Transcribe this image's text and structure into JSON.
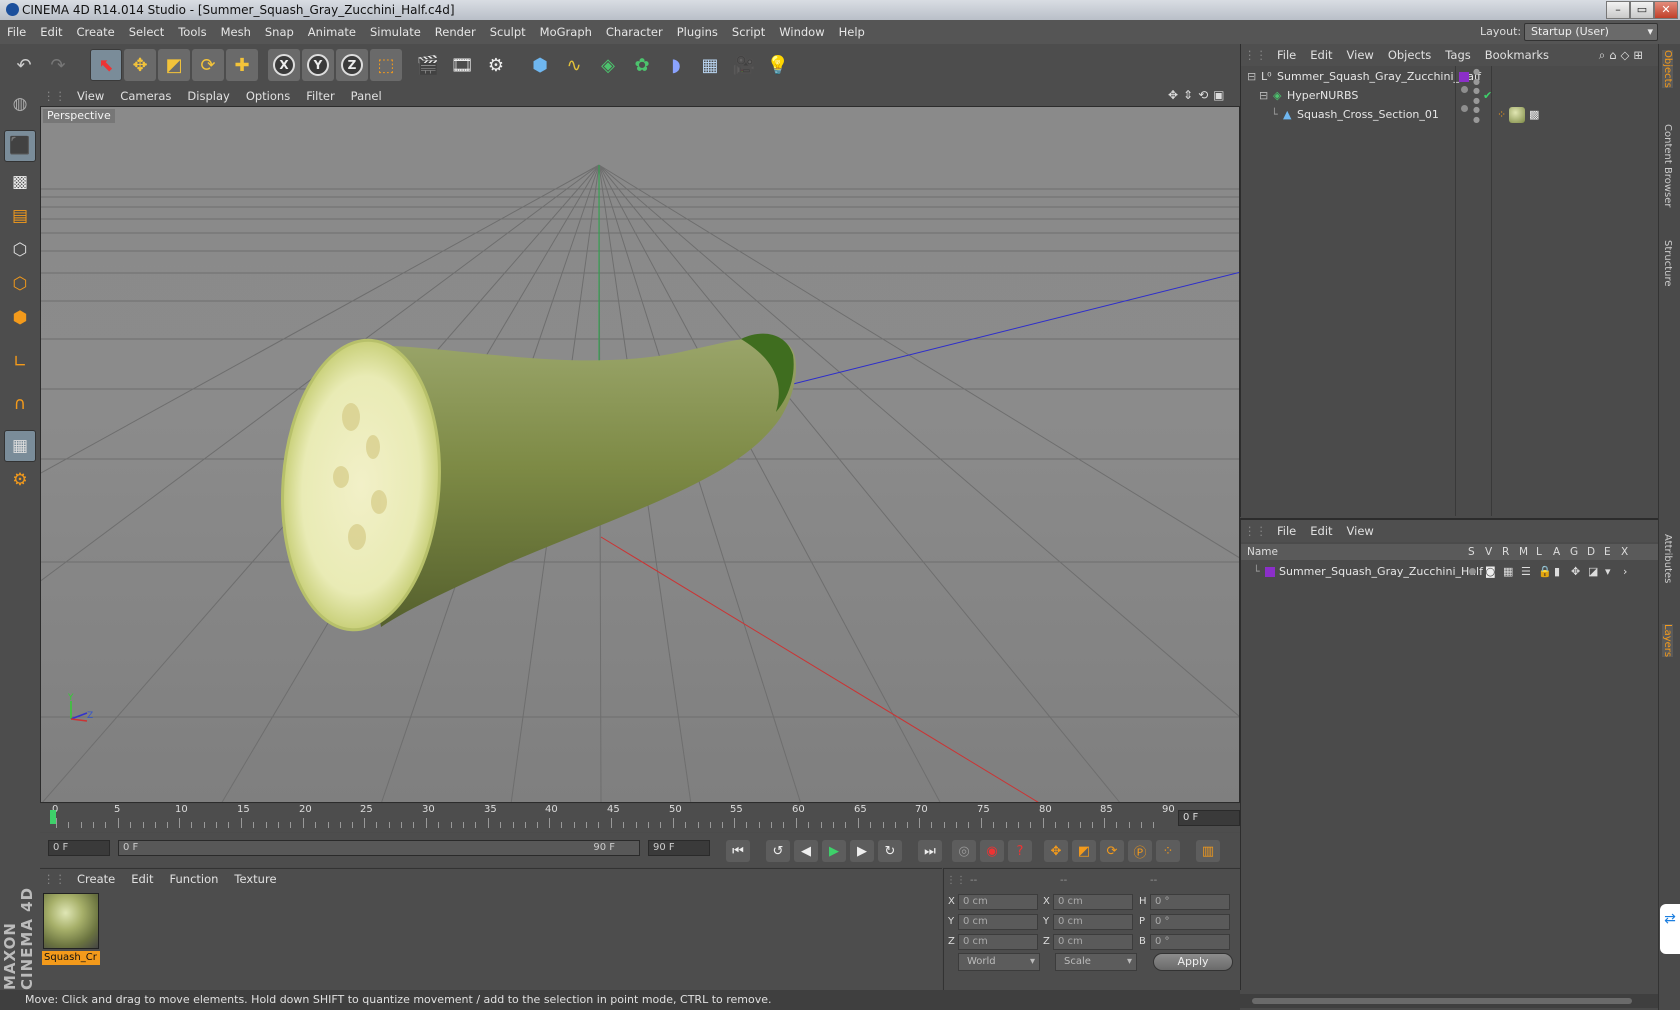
{
  "window": {
    "title": "CINEMA 4D R14.014 Studio - [Summer_Squash_Gray_Zucchini_Half.c4d]",
    "minimize": "–",
    "maximize": "▭",
    "close": "✕"
  },
  "menubar": {
    "items": [
      "File",
      "Edit",
      "Create",
      "Select",
      "Tools",
      "Mesh",
      "Snap",
      "Animate",
      "Simulate",
      "Render",
      "Sculpt",
      "MoGraph",
      "Character",
      "Plugins",
      "Script",
      "Window",
      "Help"
    ],
    "layout_label": "Layout:",
    "layout_value": "Startup (User)"
  },
  "viewport": {
    "menu": [
      "View",
      "Cameras",
      "Display",
      "Options",
      "Filter",
      "Panel"
    ],
    "camera_label": "Perspective",
    "axis_y": "Y",
    "axis_z": "Z"
  },
  "timeline": {
    "ticks": [
      "0",
      "5",
      "10",
      "15",
      "20",
      "25",
      "30",
      "35",
      "40",
      "45",
      "50",
      "55",
      "60",
      "65",
      "70",
      "75",
      "80",
      "85",
      "90"
    ],
    "current_frame": "0 F",
    "start_frame": "0 F",
    "range_start": "0 F",
    "range_end": "90 F",
    "end_frame": "90 F"
  },
  "material_manager": {
    "menu": [
      "Create",
      "Edit",
      "Function",
      "Texture"
    ],
    "material_name": "Squash_Cr"
  },
  "coordinates": {
    "headers": [
      "--",
      "--",
      "--"
    ],
    "rows": [
      {
        "a": "X",
        "av": "0 cm",
        "b": "X",
        "bv": "0 cm",
        "c": "H",
        "cv": "0 °"
      },
      {
        "a": "Y",
        "av": "0 cm",
        "b": "Y",
        "bv": "0 cm",
        "c": "P",
        "cv": "0 °"
      },
      {
        "a": "Z",
        "av": "0 cm",
        "b": "Z",
        "bv": "0 cm",
        "c": "B",
        "cv": "0 °"
      }
    ],
    "mode": "World",
    "size_mode": "Scale",
    "apply": "Apply"
  },
  "status": "Move: Click and drag to move elements. Hold down SHIFT to quantize movement / add to the selection in point mode, CTRL to remove.",
  "object_manager": {
    "menu": [
      "File",
      "Edit",
      "View",
      "Objects",
      "Tags",
      "Bookmarks"
    ],
    "objects": [
      {
        "name": "Summer_Squash_Gray_Zucchini_Half"
      },
      {
        "name": "HyperNURBS"
      },
      {
        "name": "Squash_Cross_Section_01"
      }
    ]
  },
  "layer_manager": {
    "menu": [
      "File",
      "Edit",
      "View"
    ],
    "columns": [
      "Name",
      "S",
      "V",
      "R",
      "M",
      "L",
      "A",
      "G",
      "D",
      "E",
      "X"
    ],
    "layers": [
      {
        "name": "Summer_Squash_Gray_Zucchini_Half"
      }
    ]
  },
  "side_tabs": [
    "Objects",
    "Content Browser",
    "Structure",
    "Attributes",
    "Layers"
  ],
  "brand": "MAXON CINEMA 4D",
  "colors": {
    "accent": "#f39a1b",
    "selection": "#7a8c99",
    "layer": "#8b2fc9"
  }
}
